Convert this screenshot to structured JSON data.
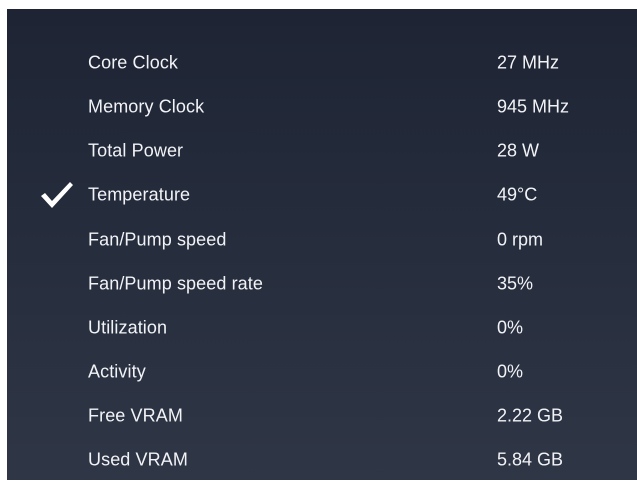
{
  "menu": {
    "items": [
      {
        "label": "Core Clock",
        "value": "27 MHz",
        "checked": false
      },
      {
        "label": "Memory Clock",
        "value": "945 MHz",
        "checked": false
      },
      {
        "label": "Total Power",
        "value": "28 W",
        "checked": false
      },
      {
        "label": "Temperature",
        "value": "49°C",
        "checked": true
      },
      {
        "label": "Fan/Pump speed",
        "value": "0 rpm",
        "checked": false
      },
      {
        "label": "Fan/Pump speed rate",
        "value": "35%",
        "checked": false
      },
      {
        "label": "Utilization",
        "value": "0%",
        "checked": false
      },
      {
        "label": "Activity",
        "value": "0%",
        "checked": false
      },
      {
        "label": "Free VRAM",
        "value": "2.22 GB",
        "checked": false
      },
      {
        "label": "Used VRAM",
        "value": "5.84 GB",
        "checked": false
      }
    ],
    "checkmark_icon": "checkmark-icon",
    "text_color": "#f2f3f6",
    "background_top": "#1e2433",
    "background_bottom": "#2f3646"
  }
}
